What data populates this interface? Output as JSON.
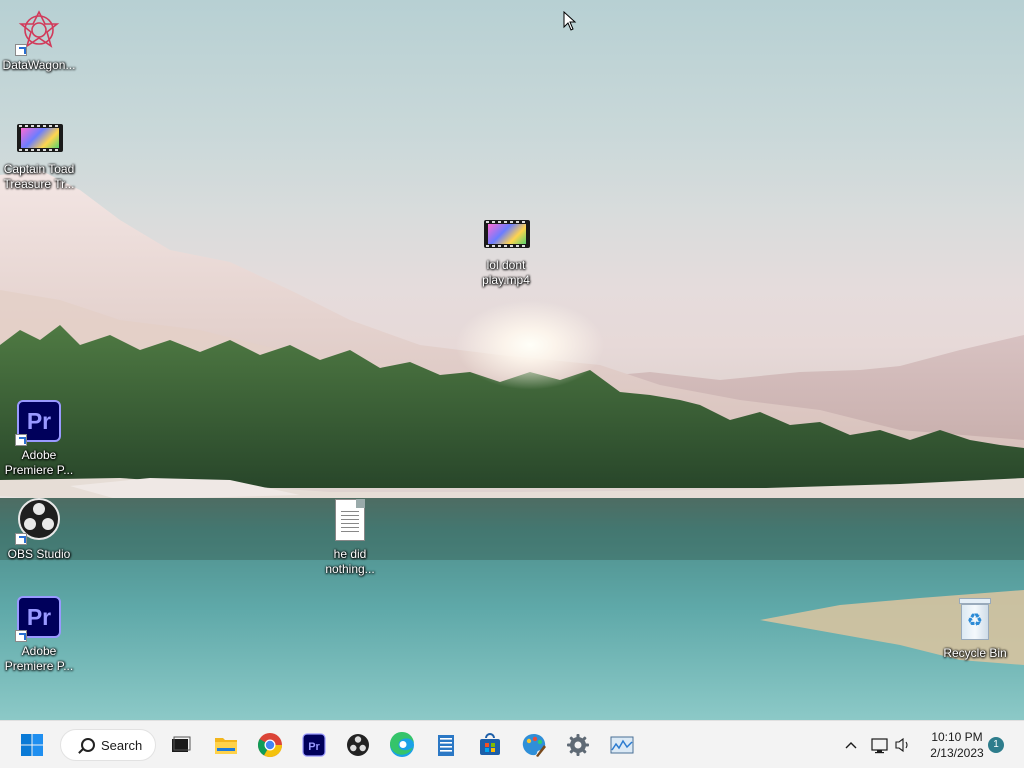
{
  "desktop": {
    "icons": [
      {
        "label": "DataWagon...",
        "icon": "datawagon-icon",
        "shortcut": true
      },
      {
        "label": "Captain Toad Treasure Tr...",
        "icon": "video-file-icon",
        "shortcut": false
      },
      {
        "label": "lol dont play.mp4",
        "icon": "video-file-icon",
        "shortcut": false
      },
      {
        "label": "Adobe Premiere P...",
        "icon": "premiere-pro-icon",
        "shortcut": true
      },
      {
        "label": "OBS Studio",
        "icon": "obs-studio-icon",
        "shortcut": true
      },
      {
        "label": "he did nothing...",
        "icon": "text-document-icon",
        "shortcut": false
      },
      {
        "label": "Adobe Premiere P...",
        "icon": "premiere-pro-icon",
        "shortcut": true
      },
      {
        "label": "Recycle Bin",
        "icon": "recycle-bin-icon",
        "shortcut": false
      }
    ],
    "premiere_abbr": "Pr"
  },
  "taskbar": {
    "search_label": "Search",
    "pinned": [
      "start-icon",
      "task-view-icon",
      "file-explorer-icon",
      "chrome-icon",
      "premiere-pro-icon",
      "obs-studio-icon",
      "edge-icon",
      "notepad-icon",
      "microsoft-store-icon",
      "paint-icon",
      "settings-icon",
      "resource-monitor-icon"
    ],
    "time": "10:10 PM",
    "date": "2/13/2023",
    "notification_count": "1"
  },
  "colors": {
    "accent": "#0067c0",
    "taskbar": "#f3f3f3"
  }
}
